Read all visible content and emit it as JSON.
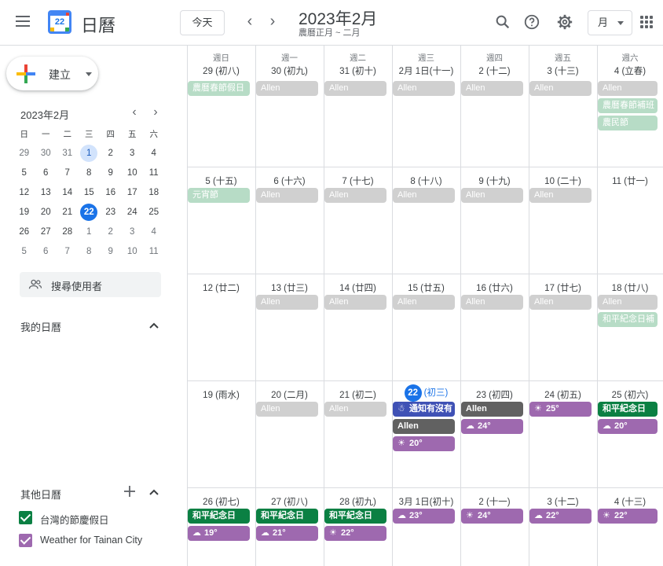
{
  "header": {
    "app_title": "日曆",
    "logo_number": "22",
    "today_button": "今天",
    "prev": "‹",
    "next": "›",
    "month_title": "2023年2月",
    "lunar_subtitle": "農曆正月 ~ 二月",
    "view_label": "月"
  },
  "sidebar": {
    "create_label": "建立",
    "mini_title": "2023年2月",
    "mini_prev": "‹",
    "mini_next": "›",
    "weekday_headers": [
      "日",
      "一",
      "二",
      "三",
      "四",
      "五",
      "六"
    ],
    "mini_weeks": [
      [
        "29",
        "30",
        "31",
        "1",
        "2",
        "3",
        "4"
      ],
      [
        "5",
        "6",
        "7",
        "8",
        "9",
        "10",
        "11"
      ],
      [
        "12",
        "13",
        "14",
        "15",
        "16",
        "17",
        "18"
      ],
      [
        "19",
        "20",
        "21",
        "22",
        "23",
        "24",
        "25"
      ],
      [
        "26",
        "27",
        "28",
        "1",
        "2",
        "3",
        "4"
      ],
      [
        "5",
        "6",
        "7",
        "8",
        "9",
        "10",
        "11"
      ]
    ],
    "search_people": "搜尋使用者",
    "my_calendars": "我的日曆",
    "other_calendars": "其他日曆",
    "calendars": [
      {
        "name": "台灣的節慶假日",
        "color": "#0b8043"
      },
      {
        "name": "Weather for Tainan City",
        "color": "#9e69af"
      }
    ]
  },
  "grid": {
    "weekdays": [
      "週日",
      "週一",
      "週二",
      "週三",
      "週四",
      "週五",
      "週六"
    ],
    "weeks": [
      {
        "days": [
          {
            "label": "29 (初八)",
            "events": [
              {
                "text": "農曆春節假日",
                "style": "holiday-faded"
              }
            ]
          },
          {
            "label": "30 (初九)",
            "events": [
              {
                "text": "Allen",
                "style": "allen-faded"
              }
            ]
          },
          {
            "label": "31 (初十)",
            "events": [
              {
                "text": "Allen",
                "style": "allen-faded"
              }
            ]
          },
          {
            "label": "2月 1日(十一)",
            "events": [
              {
                "text": "Allen",
                "style": "allen-faded"
              }
            ]
          },
          {
            "label": "2 (十二)",
            "events": [
              {
                "text": "Allen",
                "style": "allen-faded"
              }
            ]
          },
          {
            "label": "3 (十三)",
            "events": [
              {
                "text": "Allen",
                "style": "allen-faded"
              }
            ]
          },
          {
            "label": "4 (立春)",
            "events": [
              {
                "text": "Allen",
                "style": "allen-faded"
              },
              {
                "text": "農曆春節補班",
                "style": "holiday-faded"
              },
              {
                "text": "農民節",
                "style": "holiday-faded"
              }
            ]
          }
        ]
      },
      {
        "days": [
          {
            "label": "5 (十五)",
            "events": [
              {
                "text": "元宵節",
                "style": "holiday-faded"
              }
            ]
          },
          {
            "label": "6 (十六)",
            "events": [
              {
                "text": "Allen",
                "style": "allen-faded"
              }
            ]
          },
          {
            "label": "7 (十七)",
            "events": [
              {
                "text": "Allen",
                "style": "allen-faded"
              }
            ]
          },
          {
            "label": "8 (十八)",
            "events": [
              {
                "text": "Allen",
                "style": "allen-faded"
              }
            ]
          },
          {
            "label": "9 (十九)",
            "events": [
              {
                "text": "Allen",
                "style": "allen-faded"
              }
            ]
          },
          {
            "label": "10 (二十)",
            "events": [
              {
                "text": "Allen",
                "style": "allen-faded"
              }
            ]
          },
          {
            "label": "11 (廿一)",
            "events": []
          }
        ]
      },
      {
        "days": [
          {
            "label": "12 (廿二)",
            "events": []
          },
          {
            "label": "13 (廿三)",
            "events": [
              {
                "text": "Allen",
                "style": "allen-faded"
              }
            ]
          },
          {
            "label": "14 (廿四)",
            "events": [
              {
                "text": "Allen",
                "style": "allen-faded"
              }
            ]
          },
          {
            "label": "15 (廿五)",
            "events": [
              {
                "text": "Allen",
                "style": "allen-faded"
              }
            ]
          },
          {
            "label": "16 (廿六)",
            "events": [
              {
                "text": "Allen",
                "style": "allen-faded"
              }
            ]
          },
          {
            "label": "17 (廿七)",
            "events": [
              {
                "text": "Allen",
                "style": "allen-faded"
              }
            ]
          },
          {
            "label": "18 (廿八)",
            "events": [
              {
                "text": "Allen",
                "style": "allen-faded"
              },
              {
                "text": "和平紀念日補",
                "style": "holiday-faded"
              }
            ]
          }
        ]
      },
      {
        "days": [
          {
            "label": "19 (雨水)",
            "events": []
          },
          {
            "label": "20 (二月)",
            "events": [
              {
                "text": "Allen",
                "style": "allen-faded"
              }
            ]
          },
          {
            "label": "21 (初二)",
            "events": [
              {
                "text": "Allen",
                "style": "allen-faded"
              }
            ]
          },
          {
            "label": "22",
            "today": true,
            "lunar": "(初三)",
            "events": [
              {
                "text": "通知有沒有",
                "style": "blue",
                "icon": "☃"
              },
              {
                "text": "Allen",
                "style": "allen"
              },
              {
                "text": "20°",
                "style": "weather",
                "icon": "☀"
              }
            ]
          },
          {
            "label": "23 (初四)",
            "events": [
              {
                "text": "Allen",
                "style": "allen"
              },
              {
                "text": "24°",
                "style": "weather",
                "icon": "☁"
              }
            ]
          },
          {
            "label": "24 (初五)",
            "events": [
              {
                "text": "25°",
                "style": "weather",
                "icon": "☀"
              }
            ]
          },
          {
            "label": "25 (初六)",
            "events": [
              {
                "text": "和平紀念日",
                "style": "holiday"
              },
              {
                "text": "20°",
                "style": "weather",
                "icon": "☁"
              }
            ]
          }
        ]
      },
      {
        "days": [
          {
            "label": "26 (初七)",
            "events": [
              {
                "text": "和平紀念日",
                "style": "holiday"
              },
              {
                "text": "19°",
                "style": "weather",
                "icon": "☁"
              }
            ]
          },
          {
            "label": "27 (初八)",
            "events": [
              {
                "text": "和平紀念日",
                "style": "holiday"
              },
              {
                "text": "21°",
                "style": "weather",
                "icon": "☁"
              }
            ]
          },
          {
            "label": "28 (初九)",
            "events": [
              {
                "text": "和平紀念日",
                "style": "holiday"
              },
              {
                "text": "22°",
                "style": "weather",
                "icon": "☀"
              }
            ]
          },
          {
            "label": "3月 1日(初十)",
            "events": [
              {
                "text": "23°",
                "style": "weather",
                "icon": "☁"
              }
            ]
          },
          {
            "label": "2 (十一)",
            "events": [
              {
                "text": "24°",
                "style": "weather",
                "icon": "☀"
              }
            ]
          },
          {
            "label": "3 (十二)",
            "events": [
              {
                "text": "22°",
                "style": "weather",
                "icon": "☁"
              }
            ]
          },
          {
            "label": "4 (十三)",
            "events": [
              {
                "text": "22°",
                "style": "weather",
                "icon": "☀"
              }
            ]
          }
        ]
      }
    ]
  }
}
